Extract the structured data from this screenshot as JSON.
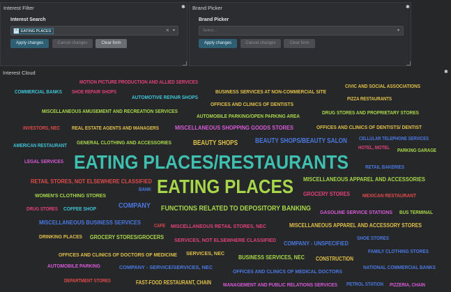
{
  "colors": {
    "background": "#262729",
    "panel": "#2c2d30",
    "primary_button": "#2e5f72",
    "chip": "#2b4a57"
  },
  "interest_filter": {
    "title": "Interest Filter",
    "field_label": "Interest Search",
    "selected_chip": "EATING PLACES",
    "chip_remove_icon": "x-icon",
    "clear_icon": "×",
    "caret_icon": "▾",
    "buttons": {
      "apply": "Apply changes",
      "cancel": "Cancel changes",
      "clear": "Clear form"
    }
  },
  "brand_picker": {
    "title": "Brand Picker",
    "field_label": "Brand Picker",
    "placeholder": "Select...",
    "caret_icon": "▾",
    "buttons": {
      "apply": "Apply changes",
      "cancel": "Cancel changes",
      "clear": "Clear form"
    }
  },
  "gear_icon": "✱",
  "interest_cloud": {
    "title": "Interest Cloud",
    "words": [
      {
        "text": "MOTION PICTURE PRODUCTION AND ALLIED SERVICES",
        "color": "#e0417a"
      },
      {
        "text": "COMMERCIAL BANKS",
        "color": "#3fc3d6"
      },
      {
        "text": "SHOE REPAIR SHOPS",
        "color": "#e0417a"
      },
      {
        "text": "AUTOMOTIVE REPAIR SHOPS",
        "color": "#3fc3d6"
      },
      {
        "text": "BUSINESS SERVICES AT NON-COMMERCIAL SITE",
        "color": "#e0c04a"
      },
      {
        "text": "CIVIC AND SOCIAL ASSOCIATIONS",
        "color": "#e0c04a"
      },
      {
        "text": "PIZZA RESTAURANTS",
        "color": "#e0c04a"
      },
      {
        "text": "OFFICES AND CLINICS OF DENTISTS",
        "color": "#e0c04a"
      },
      {
        "text": "MISCELLANEOUS AMUSEMENT AND RECREATION SERVICES",
        "color": "#a8d64a"
      },
      {
        "text": "AUTOMOBILE PARKING/OPEN PARKING AREA",
        "color": "#a8d64a"
      },
      {
        "text": "DRUG STORES AND PROPRIETARY STORES",
        "color": "#a8d64a"
      },
      {
        "text": "INVESTORS, NEC",
        "color": "#e04a4a"
      },
      {
        "text": "REAL ESTATE AGENTS AND MANAGERS",
        "color": "#e0c04a"
      },
      {
        "text": "MISCELLANEOUS SHOPPING GOODS STORES",
        "color": "#d65ad6"
      },
      {
        "text": "OFFICES AND CLINICS OF DENTISTS/ DENTIST",
        "color": "#e0c04a"
      },
      {
        "text": "AMERICAN RESTAURANT",
        "color": "#3fc3d6"
      },
      {
        "text": "GENERAL CLOTHING AND ACCESSORIES",
        "color": "#a8d64a"
      },
      {
        "text": "BEAUTY SHOPS",
        "color": "#e0c04a"
      },
      {
        "text": "BEAUTY SHOPS/BEAUTY SALON",
        "color": "#4a78e0"
      },
      {
        "text": "CELLULAR TELEPHONE SERVICES",
        "color": "#4a78e0"
      },
      {
        "text": "HOTEL, MOTEL",
        "color": "#e0417a"
      },
      {
        "text": "PARKING GARAGE",
        "color": "#a8d64a"
      },
      {
        "text": "LEGAL SERVICES",
        "color": "#d65ad6"
      },
      {
        "text": "EATING PLACES/RESTAURANTS",
        "color": "#3fbfb0"
      },
      {
        "text": "RETAIL BAKERIES",
        "color": "#4a78e0"
      },
      {
        "text": "RETAIL STORES, NOT ELSEWHERE CLASSIFIED",
        "color": "#e04a4a"
      },
      {
        "text": "EATING PLACES",
        "color": "#a8d64a"
      },
      {
        "text": "MISCELLANEOUS APPAREL AND ACCESSORIES",
        "color": "#a8d64a"
      },
      {
        "text": "BANK",
        "color": "#4a78e0"
      },
      {
        "text": "WOMEN'S CLOTHING STORES",
        "color": "#a8d64a"
      },
      {
        "text": "GROCERY STORES",
        "color": "#e0417a"
      },
      {
        "text": "MEXICAN RESTAURANT",
        "color": "#e04a4a"
      },
      {
        "text": "COMPANY",
        "color": "#4a78e0"
      },
      {
        "text": "DRUG STORES",
        "color": "#e0417a"
      },
      {
        "text": "COFFEE SHOP",
        "color": "#3fc3d6"
      },
      {
        "text": "FUNCTIONS RELATED TO DEPOSITORY BANKING",
        "color": "#a8d64a"
      },
      {
        "text": "GASOLINE SERVICE STATIONS",
        "color": "#d65ad6"
      },
      {
        "text": "BUS TERMINAL",
        "color": "#a8d64a"
      },
      {
        "text": "MISCELLANEOUS BUSINESS SERVICES",
        "color": "#4a78e0"
      },
      {
        "text": "CAFE",
        "color": "#e04a4a"
      },
      {
        "text": "MISCELLANEOUS RETAIL STORES, NEC",
        "color": "#e0417a"
      },
      {
        "text": "MISCELLANEOUS APPAREL AND ACCESSORY STORES",
        "color": "#e0c04a"
      },
      {
        "text": "DRINKING PLACES",
        "color": "#e0c04a"
      },
      {
        "text": "GROCERY STORES/GROCERS",
        "color": "#a8d64a"
      },
      {
        "text": "SERVICES, NOT ELSEWHERE CLASSIFIED",
        "color": "#e0417a"
      },
      {
        "text": "COMPANY - UNSPECIFIED",
        "color": "#4a78e0"
      },
      {
        "text": "SHOE STORES",
        "color": "#4a78e0"
      },
      {
        "text": "FAMILY CLOTHING STORES",
        "color": "#4a78e0"
      },
      {
        "text": "OFFICES AND CLINICS OF DOCTORS OF MEDICINE",
        "color": "#e0c04a"
      },
      {
        "text": "SERVICES, NEC",
        "color": "#e0c04a"
      },
      {
        "text": "BUSINESS SERVICES, NEC",
        "color": "#a8d64a"
      },
      {
        "text": "CONSTRUCTION",
        "color": "#e0c04a"
      },
      {
        "text": "AUTOMOBILE PARKING",
        "color": "#d65ad6"
      },
      {
        "text": "COMPANY - SERVICE/SERVICES, NEC",
        "color": "#4a78e0"
      },
      {
        "text": "OFFICES AND CLINICS OF MEDICAL DOCTORS",
        "color": "#4a78e0"
      },
      {
        "text": "NATIONAL COMMERCIAL BANKS",
        "color": "#4a78e0"
      },
      {
        "text": "DEPARTMENT STORES",
        "color": "#e04a4a"
      },
      {
        "text": "FAST-FOOD RESTAURANT, CHAIN",
        "color": "#e0c04a"
      },
      {
        "text": "MANAGEMENT AND PUBLIC RELATIONS SERVICES",
        "color": "#d65ad6"
      },
      {
        "text": "PETROL STATION",
        "color": "#4a78e0"
      },
      {
        "text": "PIZZERIA, CHAIN",
        "color": "#d65ad6"
      }
    ]
  }
}
